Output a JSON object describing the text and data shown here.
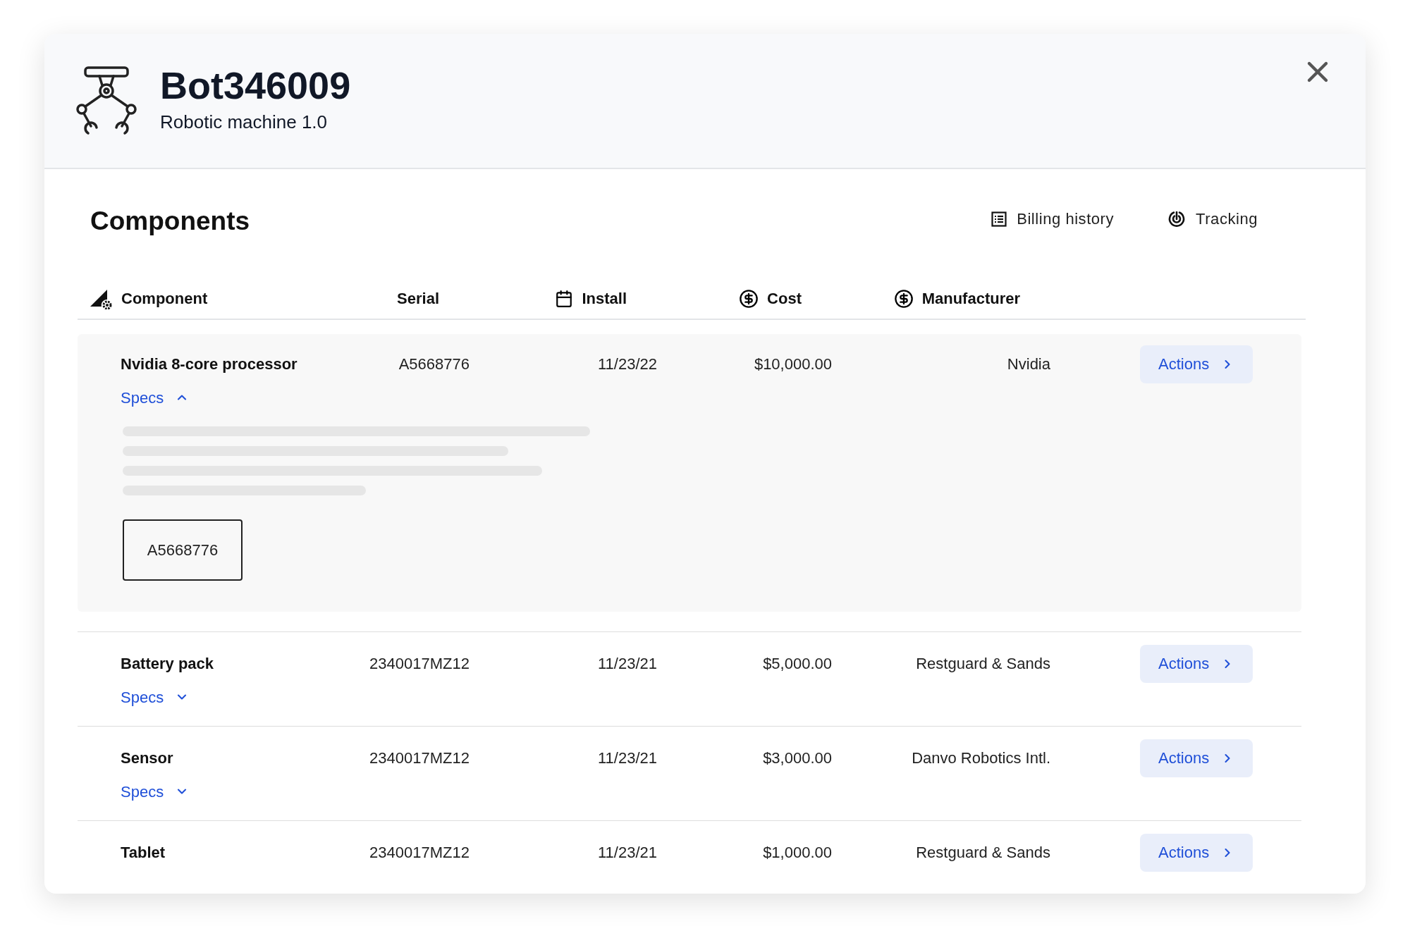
{
  "header": {
    "title": "Bot346009",
    "subtitle": "Robotic machine 1.0"
  },
  "section": {
    "title": "Components",
    "links": [
      {
        "kind": "billing",
        "label": "Billing history"
      },
      {
        "kind": "tracking",
        "label": "Tracking"
      }
    ]
  },
  "table": {
    "columns": [
      {
        "kind": "component",
        "label": "Component"
      },
      {
        "kind": "plain",
        "label": "Serial"
      },
      {
        "kind": "calendar",
        "label": "Install"
      },
      {
        "kind": "dollar",
        "label": "Cost"
      },
      {
        "kind": "dollar",
        "label": "Manufacturer"
      }
    ],
    "rows": [
      {
        "name": "Nvidia 8-core processor",
        "serial": "A5668776",
        "install": "11/23/22",
        "cost": "$10,000.00",
        "manufacturer": "Nvidia",
        "specs": "Specs",
        "expanded": true,
        "spec_value": "A5668776",
        "action": "Actions"
      },
      {
        "name": "Battery pack",
        "serial": "2340017MZ12",
        "install": "11/23/21",
        "cost": "$5,000.00",
        "manufacturer": "Restguard & Sands",
        "specs": "Specs",
        "expanded": false,
        "action": "Actions"
      },
      {
        "name": "Sensor",
        "serial": "2340017MZ12",
        "install": "11/23/21",
        "cost": "$3,000.00",
        "manufacturer": "Danvo Robotics Intl.",
        "specs": "Specs",
        "expanded": false,
        "action": "Actions"
      },
      {
        "name": "Tablet",
        "serial": "2340017MZ12",
        "install": "11/23/21",
        "cost": "$1,000.00",
        "manufacturer": "Restguard & Sands",
        "action": "Actions"
      }
    ]
  }
}
